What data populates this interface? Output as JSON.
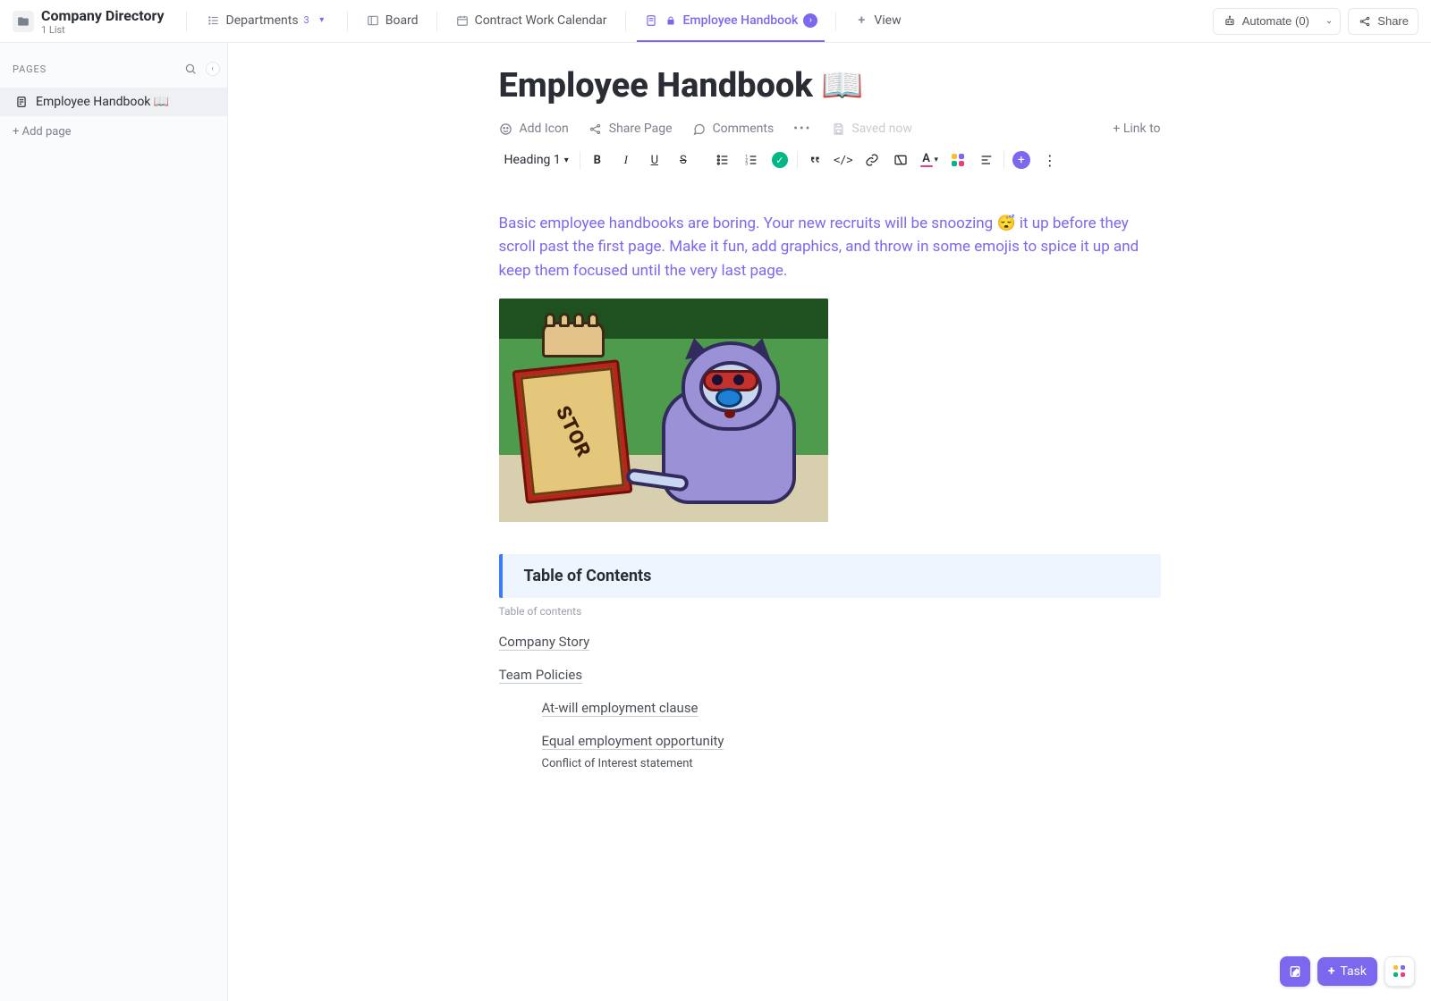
{
  "header": {
    "folder_name": "Company Directory",
    "folder_sub": "1 List",
    "tabs": [
      {
        "label": "Departments",
        "badge": "3"
      },
      {
        "label": "Board"
      },
      {
        "label": "Contract Work Calendar"
      },
      {
        "label": "Employee Handbook",
        "active": true,
        "locked": true
      },
      {
        "label": "View",
        "is_add": true
      }
    ],
    "automate_label": "Automate (0)",
    "share_label": "Share"
  },
  "sidebar": {
    "heading": "PAGES",
    "items": [
      {
        "label": "Employee Handbook 📖"
      }
    ],
    "add_page": "+ Add page"
  },
  "doc": {
    "title": "Employee Handbook 📖",
    "meta": {
      "add_icon": "Add Icon",
      "share_page": "Share Page",
      "comments": "Comments",
      "saved": "Saved now",
      "link_to": "+ Link to"
    },
    "toolbar": {
      "heading_label": "Heading 1"
    },
    "intro_before": "Basic employee handbooks are boring. Your new recruits will be snoozing ",
    "intro_emoji": "😴",
    "intro_after": " it up before they scroll past the first page. Make it fun, add graphics, and throw in some emojis to spice it up and keep them focused until the very last page.",
    "image_book_text": "STOR",
    "toc": {
      "banner_title": "Table of Contents",
      "subtitle": "Table of contents",
      "items": [
        {
          "label": "Company Story",
          "link": true,
          "level": 1
        },
        {
          "label": "Team Policies",
          "link": true,
          "level": 1
        },
        {
          "label": "At-will employment clause",
          "link": true,
          "level": 2
        },
        {
          "label": "Equal employment opportunity",
          "link": true,
          "level": 2
        },
        {
          "label": "Conflict of Interest statement",
          "link": false,
          "level": 2
        }
      ]
    }
  },
  "fab": {
    "task": "Task"
  }
}
